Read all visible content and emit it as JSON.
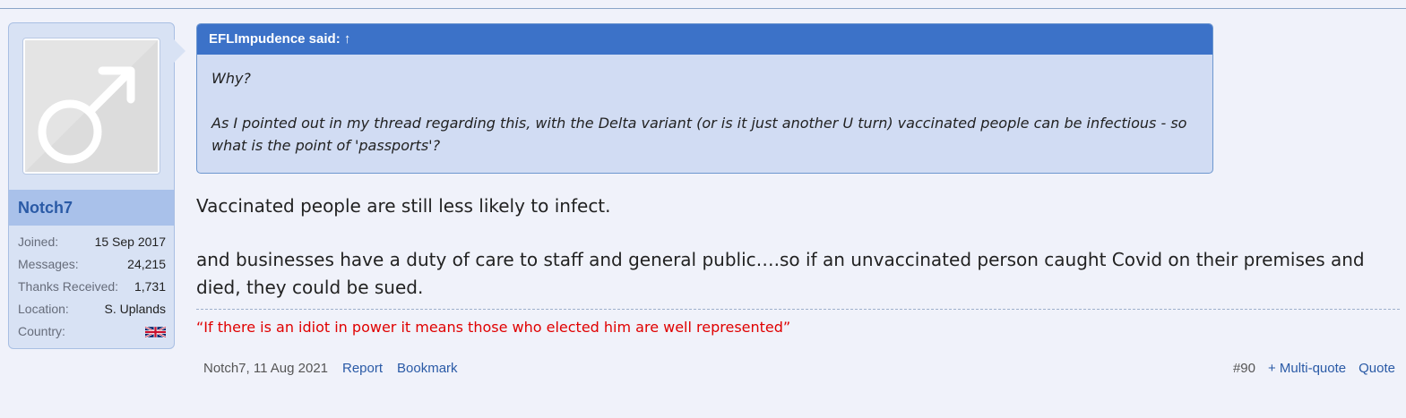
{
  "user": {
    "name": "Notch7",
    "avatar": "male-symbol-icon",
    "stats": [
      {
        "label": "Joined:",
        "value": "15 Sep 2017"
      },
      {
        "label": "Messages:",
        "value": "24,215"
      },
      {
        "label": "Thanks Received:",
        "value": "1,731"
      },
      {
        "label": "Location:",
        "value": "S. Uplands"
      },
      {
        "label": "Country:",
        "value": "uk-flag-icon"
      }
    ]
  },
  "quote": {
    "header": "EFLImpudence said: ↑",
    "paragraphs": [
      "Why?",
      "As I pointed out in my thread regarding this, with the Delta variant (or is it just another U turn) vaccinated people can be infectious - so what is the point of 'passports'?"
    ]
  },
  "message": {
    "paragraphs": [
      "Vaccinated people are still less likely to infect.",
      "and businesses have a duty of care to staff and general public….so if an unvaccinated person caught Covid on their premises and died, they could be sued."
    ]
  },
  "signature": "“If there is an idiot in power it means those who elected him are well represented”",
  "footer": {
    "author_date": "Notch7, 11 Aug 2021",
    "report": "Report",
    "bookmark": "Bookmark",
    "post_number": "#90",
    "multi_quote": "+ Multi-quote",
    "quote": "Quote"
  },
  "colors": {
    "page_bg": "#f0f2fa",
    "quote_header": "#3c72c8",
    "link": "#2a5aa6",
    "signature": "#e00000"
  }
}
